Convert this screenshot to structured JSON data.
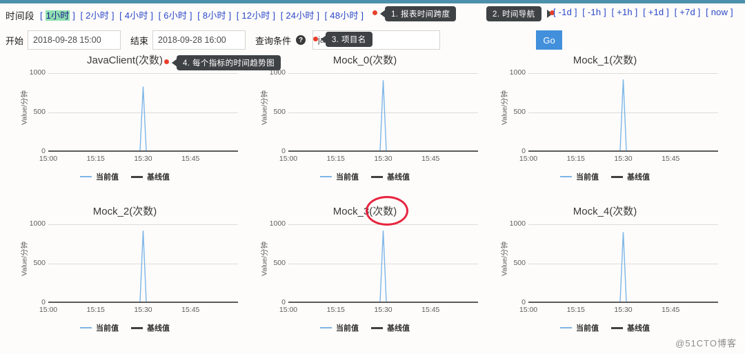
{
  "theme": {
    "accent_strip": "#4d90ab",
    "link_color": "#2b46c8",
    "selection_highlight": "#8ee0b0",
    "go_button_color": "#4290db",
    "callout_bg": "#3f4245",
    "red_dot": "#e8402a",
    "series_current_color": "#7cb5e8",
    "series_baseline_color": "#404040",
    "annotation_ellipse_color": "#e8243f"
  },
  "toolbar": {
    "time_range_label": "时间段",
    "ranges": [
      {
        "label": "1小时",
        "selected": true
      },
      {
        "label": "2小时",
        "selected": false
      },
      {
        "label": "4小时",
        "selected": false
      },
      {
        "label": "6小时",
        "selected": false
      },
      {
        "label": "8小时",
        "selected": false
      },
      {
        "label": "12小时",
        "selected": false
      },
      {
        "label": "24小时",
        "selected": false
      },
      {
        "label": "48小时",
        "selected": false
      }
    ],
    "nav_links": [
      "-1d",
      "-1h",
      "+1h",
      "+1d",
      "+7d",
      "now"
    ],
    "start_label": "开始",
    "start_value": "2018-09-28 15:00",
    "end_label": "结束",
    "end_value": "2018-09-28 16:00",
    "query_label": "查询条件",
    "help_icon_glyph": "?",
    "query_value": "javacat",
    "query_placeholder": "javacat",
    "go_label": "Go"
  },
  "callouts": [
    {
      "id": "callout-1",
      "text": "1. 报表时间跨度"
    },
    {
      "id": "callout-2",
      "text": "2. 时间导航"
    },
    {
      "id": "callout-3",
      "text": "3. 项目名"
    },
    {
      "id": "callout-4",
      "text": "4. 每个指标的时间趋势图"
    }
  ],
  "legend": {
    "current_label": "当前值",
    "baseline_label": "基线值"
  },
  "watermark": "@51CTO博客",
  "chart_data": [
    {
      "type": "line",
      "title": "JavaClient(次数)",
      "xlabel": "",
      "ylabel": "Value/分钟",
      "ylim": [
        0,
        1000
      ],
      "yticks": [
        0,
        500,
        1000
      ],
      "xticks": [
        "15:00",
        "15:15",
        "15:30",
        "15:45"
      ],
      "xlim": [
        "15:00",
        "16:00"
      ],
      "grid": true,
      "legend_position": "bottom",
      "series": [
        {
          "name": "当前值",
          "color": "#7cb5e8",
          "x": [
            "15:00",
            "15:28",
            "15:29",
            "15:30",
            "15:31",
            "15:32",
            "16:00"
          ],
          "values": [
            0,
            0,
            0,
            830,
            0,
            0,
            0
          ]
        },
        {
          "name": "基线值",
          "color": "#404040",
          "x": [
            "15:00",
            "16:00"
          ],
          "values": [
            0,
            0
          ]
        }
      ]
    },
    {
      "type": "line",
      "title": "Mock_0(次数)",
      "xlabel": "",
      "ylabel": "Value/分钟",
      "ylim": [
        0,
        1000
      ],
      "yticks": [
        0,
        500,
        1000
      ],
      "xticks": [
        "15:00",
        "15:15",
        "15:30",
        "15:45"
      ],
      "xlim": [
        "15:00",
        "16:00"
      ],
      "grid": true,
      "legend_position": "bottom",
      "series": [
        {
          "name": "当前值",
          "color": "#7cb5e8",
          "x": [
            "15:00",
            "15:29",
            "15:30",
            "15:31",
            "16:00"
          ],
          "values": [
            0,
            0,
            910,
            0,
            0
          ]
        },
        {
          "name": "基线值",
          "color": "#404040",
          "x": [
            "15:00",
            "16:00"
          ],
          "values": [
            0,
            0
          ]
        }
      ]
    },
    {
      "type": "line",
      "title": "Mock_1(次数)",
      "xlabel": "",
      "ylabel": "Value/分钟",
      "ylim": [
        0,
        1000
      ],
      "yticks": [
        0,
        500,
        1000
      ],
      "xticks": [
        "15:00",
        "15:15",
        "15:30",
        "15:45"
      ],
      "xlim": [
        "15:00",
        "16:00"
      ],
      "grid": true,
      "legend_position": "bottom",
      "series": [
        {
          "name": "当前值",
          "color": "#7cb5e8",
          "x": [
            "15:00",
            "15:29",
            "15:30",
            "15:31",
            "16:00"
          ],
          "values": [
            0,
            0,
            920,
            0,
            0
          ]
        },
        {
          "name": "基线值",
          "color": "#404040",
          "x": [
            "15:00",
            "16:00"
          ],
          "values": [
            0,
            0
          ]
        }
      ]
    },
    {
      "type": "line",
      "title": "Mock_2(次数)",
      "xlabel": "",
      "ylabel": "Value/分钟",
      "ylim": [
        0,
        1000
      ],
      "yticks": [
        0,
        500,
        1000
      ],
      "xticks": [
        "15:00",
        "15:15",
        "15:30",
        "15:45"
      ],
      "xlim": [
        "15:00",
        "16:00"
      ],
      "grid": true,
      "legend_position": "bottom",
      "series": [
        {
          "name": "当前值",
          "color": "#7cb5e8",
          "x": [
            "15:00",
            "15:29",
            "15:30",
            "15:31",
            "16:00"
          ],
          "values": [
            0,
            0,
            920,
            0,
            0
          ]
        },
        {
          "name": "基线值",
          "color": "#404040",
          "x": [
            "15:00",
            "16:00"
          ],
          "values": [
            0,
            0
          ]
        }
      ]
    },
    {
      "type": "line",
      "title": "Mock_3(次数)",
      "xlabel": "",
      "ylabel": "Value/分钟",
      "ylim": [
        0,
        1000
      ],
      "yticks": [
        0,
        500,
        1000
      ],
      "xticks": [
        "15:00",
        "15:15",
        "15:30",
        "15:45"
      ],
      "xlim": [
        "15:00",
        "16:00"
      ],
      "grid": true,
      "legend_position": "bottom",
      "annotation": "red-ellipse-around-次数",
      "series": [
        {
          "name": "当前值",
          "color": "#7cb5e8",
          "x": [
            "15:00",
            "15:29",
            "15:30",
            "15:31",
            "16:00"
          ],
          "values": [
            0,
            0,
            920,
            0,
            0
          ]
        },
        {
          "name": "基线值",
          "color": "#404040",
          "x": [
            "15:00",
            "16:00"
          ],
          "values": [
            0,
            0
          ]
        }
      ]
    },
    {
      "type": "line",
      "title": "Mock_4(次数)",
      "xlabel": "",
      "ylabel": "Value/分钟",
      "ylim": [
        0,
        1000
      ],
      "yticks": [
        0,
        500,
        1000
      ],
      "xticks": [
        "15:00",
        "15:15",
        "15:30",
        "15:45"
      ],
      "xlim": [
        "15:00",
        "16:00"
      ],
      "grid": true,
      "legend_position": "bottom",
      "series": [
        {
          "name": "当前值",
          "color": "#7cb5e8",
          "x": [
            "15:00",
            "15:29",
            "15:30",
            "15:31",
            "16:00"
          ],
          "values": [
            0,
            0,
            900,
            0,
            0
          ]
        },
        {
          "name": "基线值",
          "color": "#404040",
          "x": [
            "15:00",
            "16:00"
          ],
          "values": [
            0,
            0
          ]
        }
      ]
    }
  ]
}
